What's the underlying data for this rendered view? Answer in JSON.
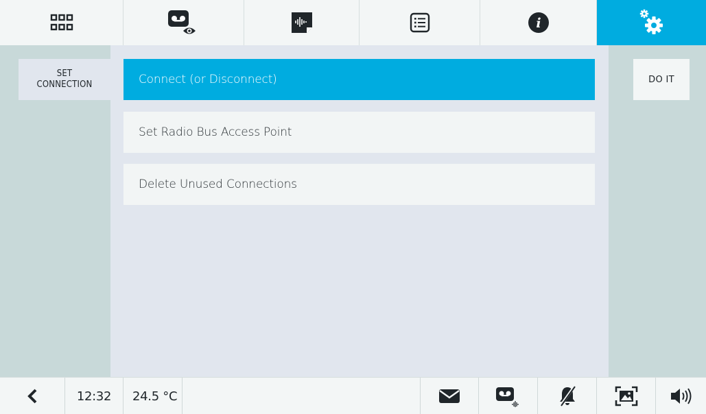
{
  "top_tabs": [
    {
      "name": "apps-grid-icon"
    },
    {
      "name": "video-message-view-icon"
    },
    {
      "name": "audio-memo-icon"
    },
    {
      "name": "list-icon"
    },
    {
      "name": "info-icon"
    },
    {
      "name": "settings-gears-icon",
      "active": true
    }
  ],
  "section": {
    "label": "SET\nCONNECTION"
  },
  "menu": {
    "items": [
      {
        "label": "Connect (or Disconnect)",
        "selected": true
      },
      {
        "label": "Set Radio Bus Access Point",
        "selected": false
      },
      {
        "label": "Delete Unused Connections",
        "selected": false
      }
    ]
  },
  "action": {
    "do_it_label": "DO IT"
  },
  "status": {
    "time": "12:32",
    "temperature": "24.5 °C"
  },
  "bottom_icons": [
    "back-chevron-icon",
    "envelope-icon",
    "voicemail-audio-icon",
    "ringer-muted-icon",
    "picture-frame-icon",
    "speaker-volume-icon"
  ],
  "colors": {
    "accent": "#00ace0",
    "side_panel": "#c8d9d9",
    "content_bg": "#e1e6ee",
    "item_bg": "#f2f5f5",
    "text": "#20262a"
  }
}
